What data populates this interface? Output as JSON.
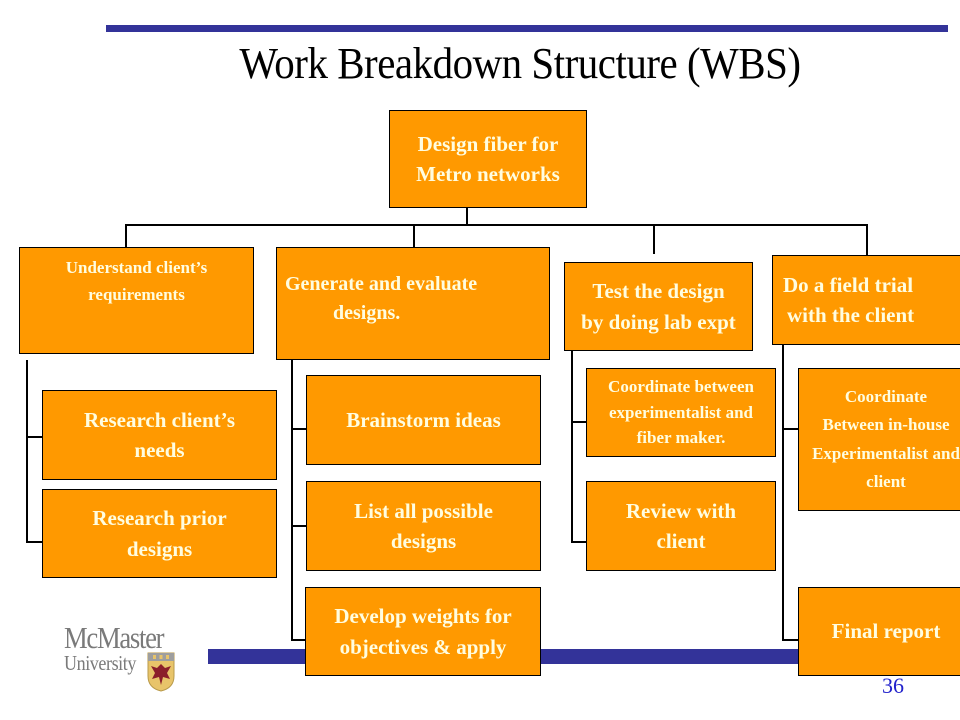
{
  "slide": {
    "title": "Work Breakdown Structure (WBS)",
    "page_number": "36",
    "accent_color": "#333399",
    "box_color": "#ff9900",
    "text_color": "#fffde0"
  },
  "logo": {
    "line1": "McMaster",
    "line2": "University"
  },
  "wbs": {
    "root": {
      "lines": [
        "Design fiber for",
        "Metro networks"
      ]
    },
    "branches": [
      {
        "lines": [
          "Understand client’s",
          "requirements"
        ],
        "children": [
          {
            "lines": [
              "Research client’s",
              "needs"
            ]
          },
          {
            "lines": [
              "Research prior",
              "designs"
            ]
          }
        ]
      },
      {
        "lines": [
          "Generate and evaluate",
          "designs."
        ],
        "children": [
          {
            "lines": [
              "Brainstorm ideas"
            ]
          },
          {
            "lines": [
              "List all possible",
              "designs"
            ]
          },
          {
            "lines": [
              "Develop weights for",
              "objectives & apply"
            ]
          }
        ]
      },
      {
        "lines": [
          "Test the design",
          "by doing lab expt"
        ],
        "children": [
          {
            "lines": [
              "Coordinate between",
              "experimentalist and",
              "fiber maker."
            ]
          },
          {
            "lines": [
              "Review with",
              "client"
            ]
          }
        ]
      },
      {
        "lines": [
          "Do a field trial",
          "with the client"
        ],
        "children": [
          {
            "lines": [
              "Coordinate",
              "Between in-house",
              "Experimentalist and",
              "client"
            ]
          },
          {
            "lines": [
              "Final report"
            ]
          }
        ]
      }
    ]
  }
}
